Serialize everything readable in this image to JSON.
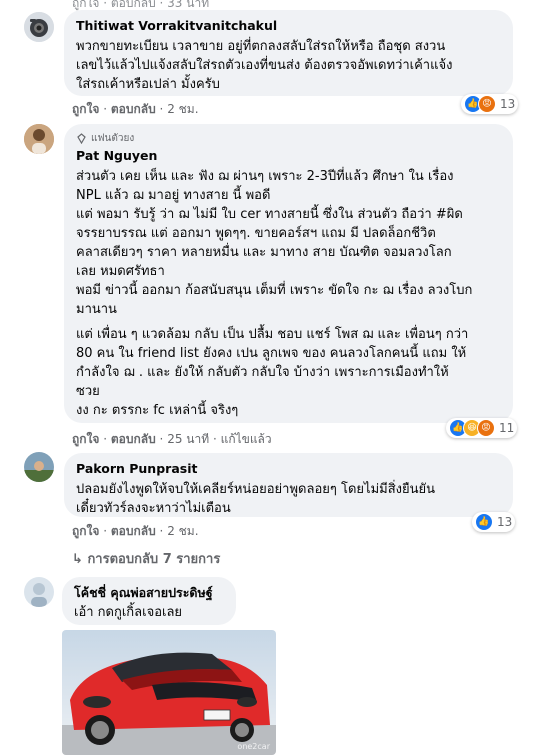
{
  "top_partial_actions": "ถูกใจ · ตอบกลับ · 33 นาที",
  "comments": [
    {
      "name": "Thitiwat Vorrakitvanitchakul",
      "lines": [
        "พวกขายทะเบียน เวลาขาย อยู่ที่ตกลงสลับใส่รถให้หรือ ถือชุด สงวน",
        "เลขไว้แล้วไปแจ้งสลับใส่รถตัวเองที่ขนส่ง ต้องตรวจอัพเดทว่าเค้าแจ้ง",
        "ใส่รถเค้าหรือเปล่า มั้งครับ"
      ],
      "like": "ถูกใจ",
      "reply": "ตอบกลับ",
      "time": "2 ชม.",
      "reaction_count": "13"
    },
    {
      "badge": "แฟนตัวยง",
      "name": "Pat Nguyen",
      "paragraphs": [
        [
          "ส่วนตัว เคย เห็น และ ฟัง ฌ ผ่านๆ เพราะ 2-3ปีที่แล้ว ศึกษา ใน เรื่อง",
          "NPL แล้ว ฌ มาอยู่ ทางสาย นี้ พอดี"
        ],
        [
          "แต่ พอมา รับรู้ ว่า ฌ ไม่มี ใบ cer ทางสายนี้ ซึ่งใน ส่วนตัว ถือว่า #ผิด",
          "จรรยาบรรณ แต่ ออกมา พูดๆๆ. ขายคอร์สฯ แถม มี ปลดล็อกชีวิต",
          "คลาสเดียวๆ ราคา หลายหมื่น และ มาทาง สาย บัณฑิต จอมลวงโลก",
          "เลย หมดศรัทธา"
        ],
        [
          "พอมี ข่าวนี้ ออกมา ก้อสนับสนุน เต็มที่ เพราะ ขัดใจ กะ ฌ เรื่อง ลวงโบก",
          "มานาน"
        ],
        [
          "แต่ เพื่อน ๆ แวดล้อม กลับ เป็น ปลื้ม ชอบ แชร์ โพส ฌ และ เพื่อนๆ กว่า",
          "80 คน ใน friend list ยังคง เปน ลูกเพจ ของ คนลวงโลกคนนี้ แถม ให้",
          "กำลังใจ ฌ . และ ยังให้ กลับตัว กลับใจ บ้างว่า เพราะการเมืองทำให้",
          "ซวย",
          "งง กะ ตรรกะ fc เหล่านี้ จริงๆ"
        ]
      ],
      "like": "ถูกใจ",
      "reply": "ตอบกลับ",
      "time": "25 นาที",
      "edited": "แก้ไขแล้ว",
      "reaction_count": "11"
    },
    {
      "name": "Pakorn Punprasit",
      "lines": [
        "ปลอมยังไงพูดให้จบให้เคลียร์หน่อยอย่าพูดลอยๆ โดยไม่มีสิ่งยืนยัน",
        "เดี๋ยวทัวร์ลงจะหาว่าไม่เตือน"
      ],
      "like": "ถูกใจ",
      "reply": "ตอบกลับ",
      "time": "2 ชม.",
      "reaction_count": "13"
    }
  ],
  "view_replies": "การตอบกลับ 7 รายการ",
  "last_comment": {
    "name": "โค้ชชี่ คุณพ่อสายประดิษฐ์",
    "text": "เอ้า กดกูเกิ้ลเจอเลย",
    "watermark": "one2car"
  },
  "colors": {
    "bubble": "#f0f2f5",
    "like": "#1877f2",
    "haha": "#f7b125",
    "angry": "#e9710f",
    "car": "#e02a2a"
  }
}
